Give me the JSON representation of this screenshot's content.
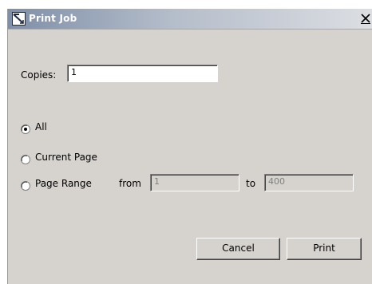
{
  "window": {
    "title": "Print Job",
    "close_glyph": "X"
  },
  "copies": {
    "label": "Copies:",
    "value": "1"
  },
  "range_options": [
    {
      "label": "All",
      "selected": true
    },
    {
      "label": "Current Page",
      "selected": false
    },
    {
      "label": "Page Range",
      "selected": false
    }
  ],
  "page_range": {
    "from_label": "from",
    "from_value": "1",
    "to_label": "to",
    "to_value": "400"
  },
  "buttons": {
    "cancel": "Cancel",
    "print": "Print"
  },
  "icons": {
    "title": "print-job-icon",
    "close": "close-icon"
  },
  "colors": {
    "dialog_bg": "#d6d3ce",
    "title_gradient_start": "#7f8fa8",
    "disabled_text": "#808080"
  }
}
